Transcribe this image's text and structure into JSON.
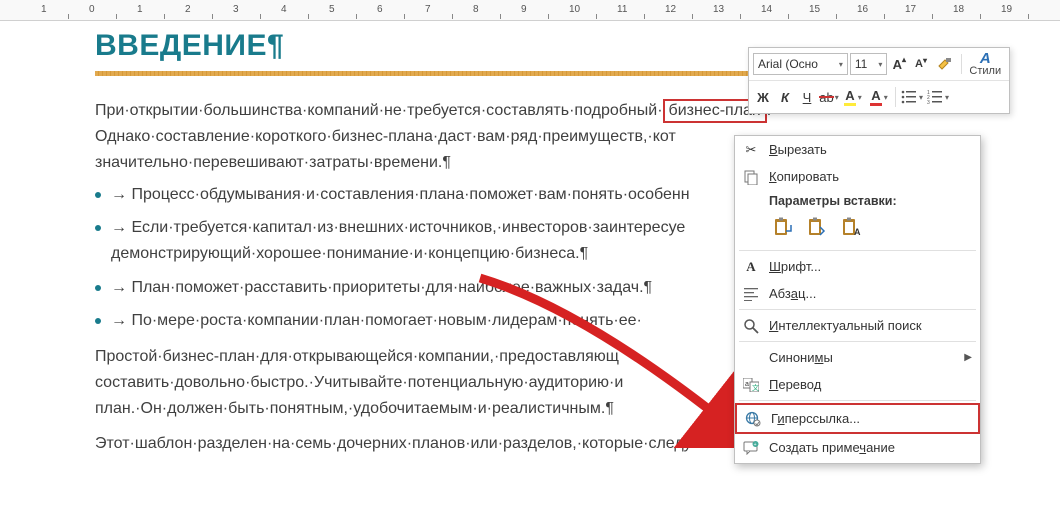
{
  "ruler": {
    "unit": "cm",
    "start": -1,
    "end": 19
  },
  "document": {
    "heading": "ВВЕДЕНИЕ¶",
    "para1_a": "При·открытии·большинства·компаний·не·требуется·составлять·подробный·",
    "para1_sel": "бизнес-план",
    "para1_b": ".·",
    "para1_c": "Однако·составление·короткого·бизнес-плана·даст·вам·ряд·преимуществ,·кот",
    "para1_d": "значительно·перевешивают·затраты·времени.¶",
    "bullets": [
      "→ Процесс·обдумывания·и·составления·плана·поможет·вам·понять·особенн",
      "→ Если·требуется·капитал·из·внешних·источников,·инвесторов·заинтересуе демонстрирующий·хорошее·понимание·и·концепцию·бизнеса.¶",
      "→ План·поможет·расставить·приоритеты·для·наиболее·важных·задач.¶",
      "→ По·мере·роста·компании·план·помогает·новым·лидерам·понять·ее·"
    ],
    "para2": "Простой·бизнес-план·для·открывающейся·компании,·предоставляющ составить·довольно·быстро.·Учитывайте·потенциальную·аудиторию·и план.·Он·должен·быть·понятным,·удобочитаемым·и·реалистичным.¶",
    "para3": "Этот·шаблон·разделен·на·семь·дочерних·планов·или·разделов,·которые·следует·заполнить.¶"
  },
  "mini_toolbar": {
    "font_name": "Arial (Осно",
    "font_size": "11",
    "styles_label": "Стили"
  },
  "context_menu": {
    "cut": "Вырезать",
    "copy": "Копировать",
    "paste_header": "Параметры вставки:",
    "font": "Шрифт...",
    "paragraph": "Абзац...",
    "smart_lookup": "Интеллектуальный поиск",
    "synonyms": "Синонимы",
    "translate": "Перевод",
    "hyperlink": "Гиперссылка...",
    "new_comment": "Создать примечание"
  }
}
